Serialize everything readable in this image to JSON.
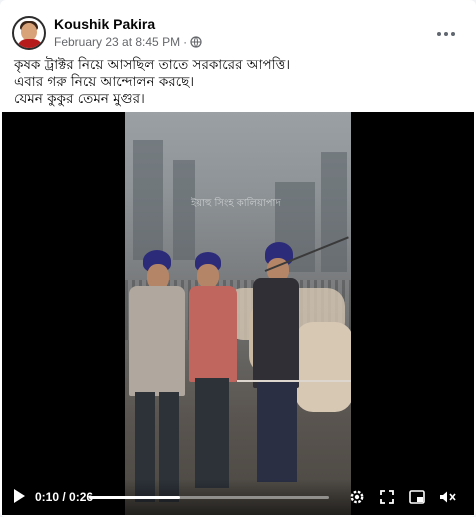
{
  "post": {
    "author": "Koushik Pakira",
    "timestamp": "February 23 at 8:45 PM",
    "separator": "·",
    "privacy_icon": "globe-icon",
    "menu_icon": "more-options-icon",
    "text_lines": [
      "কৃষক ট্রাক্টর নিয়ে আসছিল তাতে সরকারের আপত্তি।",
      "এবার গরু নিয়ে আন্দোলন করছে।",
      "যেমন কুকুর তেমন মুগুর।"
    ]
  },
  "video": {
    "overlay_text": "ইয়াহু সিংহ কালিয়াপাদ",
    "time_display": "0:10 / 0:26",
    "progress": 0.38,
    "controls": [
      "play-icon",
      "settings-icon",
      "fullscreen-icon",
      "picture-in-picture-icon",
      "volume-icon"
    ]
  },
  "colors": {
    "name": "#050505",
    "meta": "#65676b",
    "turban": "#2b2b7a",
    "video_bg": "#000000"
  }
}
